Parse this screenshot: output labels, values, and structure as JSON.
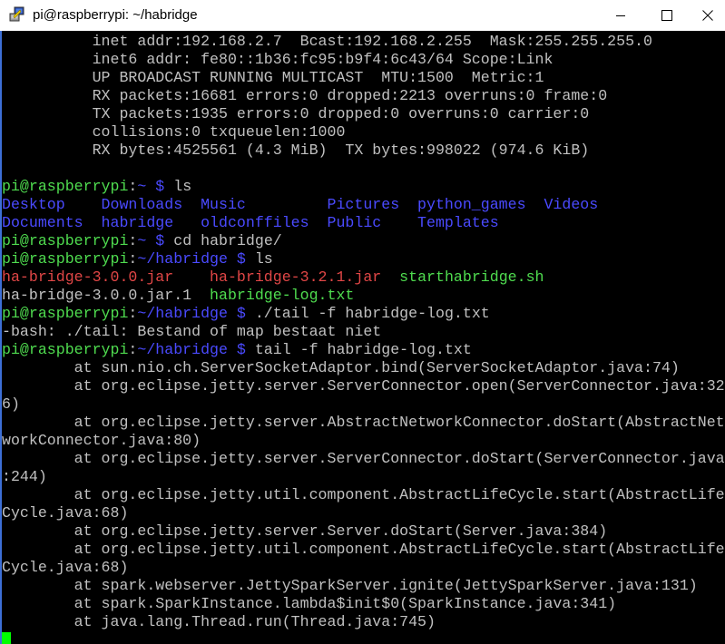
{
  "window": {
    "title": "pi@raspberrypi: ~/habridge",
    "icon": "putty-icon",
    "controls": {
      "minimize": "minimize-icon",
      "maximize": "maximize-icon",
      "close": "close-icon"
    }
  },
  "colors": {
    "background": "#000000",
    "default_text": "#c0c0c0",
    "prompt_user": "#4fdc4f",
    "prompt_path": "#4a4aff",
    "directory": "#4a4aff",
    "archive": "#e04646",
    "executable": "#4fdc4f",
    "cursor": "#00ff00"
  },
  "terminal": {
    "lines": [
      [
        {
          "t": "          inet addr:192.168.2.7  Bcast:192.168.2.255  Mask:255.255.255.0",
          "c": "grey"
        }
      ],
      [
        {
          "t": "          inet6 addr: fe80::1b36:fc95:b9f4:6c43/64 Scope:Link",
          "c": "grey"
        }
      ],
      [
        {
          "t": "          UP BROADCAST RUNNING MULTICAST  MTU:1500  Metric:1",
          "c": "grey"
        }
      ],
      [
        {
          "t": "          RX packets:16681 errors:0 dropped:2213 overruns:0 frame:0",
          "c": "grey"
        }
      ],
      [
        {
          "t": "          TX packets:1935 errors:0 dropped:0 overruns:0 carrier:0",
          "c": "grey"
        }
      ],
      [
        {
          "t": "          collisions:0 txqueuelen:1000",
          "c": "grey"
        }
      ],
      [
        {
          "t": "          RX bytes:4525561 (4.3 MiB)  TX bytes:998022 (974.6 KiB)",
          "c": "grey"
        }
      ],
      [
        {
          "t": "",
          "c": "grey"
        }
      ],
      [
        {
          "t": "pi@raspberrypi",
          "c": "green"
        },
        {
          "t": ":",
          "c": "grey"
        },
        {
          "t": "~ $ ",
          "c": "blue"
        },
        {
          "t": "ls",
          "c": "grey"
        }
      ],
      [
        {
          "t": "Desktop    Downloads  Music         Pictures  python_games  Videos",
          "c": "blue"
        }
      ],
      [
        {
          "t": "Documents  habridge   oldconffiles  Public    Templates",
          "c": "blue"
        }
      ],
      [
        {
          "t": "pi@raspberrypi",
          "c": "green"
        },
        {
          "t": ":",
          "c": "grey"
        },
        {
          "t": "~ $ ",
          "c": "blue"
        },
        {
          "t": "cd habridge/",
          "c": "grey"
        }
      ],
      [
        {
          "t": "pi@raspberrypi",
          "c": "green"
        },
        {
          "t": ":",
          "c": "grey"
        },
        {
          "t": "~/habridge $ ",
          "c": "blue"
        },
        {
          "t": "ls",
          "c": "grey"
        }
      ],
      [
        {
          "t": "ha-bridge-3.0.0.jar    ha-bridge-3.2.1.jar  ",
          "c": "red"
        },
        {
          "t": "starthabridge.sh",
          "c": "green"
        }
      ],
      [
        {
          "t": "ha-bridge-3.0.0.jar.1  ",
          "c": "grey"
        },
        {
          "t": "habridge-log.txt",
          "c": "green"
        }
      ],
      [
        {
          "t": "pi@raspberrypi",
          "c": "green"
        },
        {
          "t": ":",
          "c": "grey"
        },
        {
          "t": "~/habridge $ ",
          "c": "blue"
        },
        {
          "t": "./tail -f habridge-log.txt",
          "c": "grey"
        }
      ],
      [
        {
          "t": "-bash: ./tail: Bestand of map bestaat niet",
          "c": "grey"
        }
      ],
      [
        {
          "t": "pi@raspberrypi",
          "c": "green"
        },
        {
          "t": ":",
          "c": "grey"
        },
        {
          "t": "~/habridge $ ",
          "c": "blue"
        },
        {
          "t": "tail -f habridge-log.txt",
          "c": "grey"
        }
      ],
      [
        {
          "t": "        at sun.nio.ch.ServerSocketAdaptor.bind(ServerSocketAdaptor.java:74)",
          "c": "grey"
        }
      ],
      [
        {
          "t": "        at org.eclipse.jetty.server.ServerConnector.open(ServerConnector.java:32",
          "c": "grey"
        }
      ],
      [
        {
          "t": "6)",
          "c": "grey"
        }
      ],
      [
        {
          "t": "        at org.eclipse.jetty.server.AbstractNetworkConnector.doStart(AbstractNet",
          "c": "grey"
        }
      ],
      [
        {
          "t": "workConnector.java:80)",
          "c": "grey"
        }
      ],
      [
        {
          "t": "        at org.eclipse.jetty.server.ServerConnector.doStart(ServerConnector.java",
          "c": "grey"
        }
      ],
      [
        {
          "t": ":244)",
          "c": "grey"
        }
      ],
      [
        {
          "t": "        at org.eclipse.jetty.util.component.AbstractLifeCycle.start(AbstractLife",
          "c": "grey"
        }
      ],
      [
        {
          "t": "Cycle.java:68)",
          "c": "grey"
        }
      ],
      [
        {
          "t": "        at org.eclipse.jetty.server.Server.doStart(Server.java:384)",
          "c": "grey"
        }
      ],
      [
        {
          "t": "        at org.eclipse.jetty.util.component.AbstractLifeCycle.start(AbstractLife",
          "c": "grey"
        }
      ],
      [
        {
          "t": "Cycle.java:68)",
          "c": "grey"
        }
      ],
      [
        {
          "t": "        at spark.webserver.JettySparkServer.ignite(JettySparkServer.java:131)",
          "c": "grey"
        }
      ],
      [
        {
          "t": "        at spark.SparkInstance.lambda$init$0(SparkInstance.java:341)",
          "c": "grey"
        }
      ],
      [
        {
          "t": "        at java.lang.Thread.run(Thread.java:745)",
          "c": "grey"
        }
      ]
    ],
    "cursor_visible": true
  }
}
